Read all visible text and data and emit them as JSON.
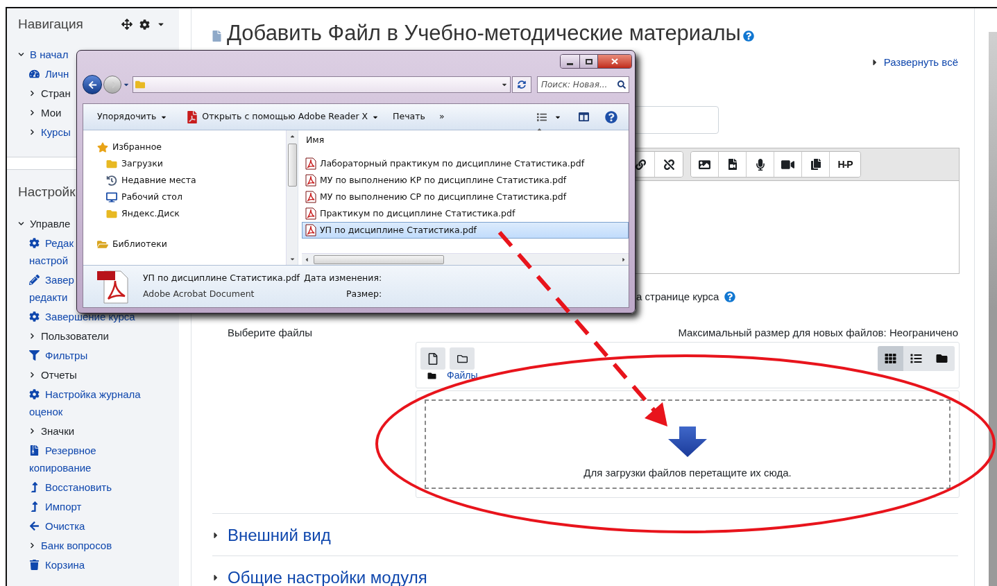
{
  "sidebar": {
    "navigation": {
      "title": "Навигация",
      "items": [
        {
          "label": [
            "В начал"
          ],
          "kind": "branch",
          "expanded": true,
          "link": true,
          "children": [
            {
              "label": [
                "Личн"
              ],
              "kind": "dashboard",
              "link": true
            },
            {
              "label": [
                "Стран"
              ],
              "kind": "branch",
              "expanded": false,
              "link": false
            },
            {
              "label": [
                "Мои"
              ],
              "kind": "branch",
              "expanded": false,
              "link": false
            },
            {
              "label": [
                "Курсы"
              ],
              "kind": "branch",
              "expanded": false,
              "link": true
            }
          ]
        }
      ]
    },
    "settings": {
      "title": "Настройк",
      "items": [
        {
          "label": [
            "Управле"
          ],
          "kind": "branch",
          "expanded": true,
          "link": false,
          "children": [
            {
              "label": [
                "Редак",
                "настрой"
              ],
              "kind": "gear",
              "link": true
            },
            {
              "label": [
                "Завер",
                "редакти"
              ],
              "kind": "pencil",
              "link": true
            },
            {
              "label": [
                "Завершение курса"
              ],
              "kind": "gear",
              "link": true
            },
            {
              "label": [
                "Пользователи"
              ],
              "kind": "branch",
              "expanded": false,
              "link": false
            },
            {
              "label": [
                "Фильтры"
              ],
              "kind": "filter",
              "link": true
            },
            {
              "label": [
                "Отчеты"
              ],
              "kind": "branch",
              "expanded": false,
              "link": false
            },
            {
              "label": [
                "Настройка журнала",
                "оценок"
              ],
              "kind": "gear",
              "link": true
            },
            {
              "label": [
                "Значки"
              ],
              "kind": "branch",
              "expanded": false,
              "link": false
            },
            {
              "label": [
                "Резервное",
                "копирование"
              ],
              "kind": "backup",
              "link": true
            },
            {
              "label": [
                "Восстановить"
              ],
              "kind": "upload",
              "link": true
            },
            {
              "label": [
                "Импорт"
              ],
              "kind": "upload",
              "link": true
            },
            {
              "label": [
                "Очистка"
              ],
              "kind": "back",
              "link": true
            },
            {
              "label": [
                "Банк вопросов"
              ],
              "kind": "branch",
              "expanded": false,
              "link": true
            },
            {
              "label": [
                "Корзина"
              ],
              "kind": "trash",
              "link": true
            }
          ]
        }
      ]
    }
  },
  "page": {
    "title": "Добавить Файл в Учебно-методические материалы",
    "expand_all": "Развернуть всё",
    "editor_h5p": "H-P",
    "option_fragment": "а странице курса",
    "file_picker": {
      "label": "Выберите файлы",
      "max_size": "Максимальный размер для новых файлов: Неограничено",
      "path": "Файлы",
      "views": [
        {
          "kind": "icons",
          "selected": true
        },
        {
          "kind": "list",
          "selected": false
        },
        {
          "kind": "tree",
          "selected": false
        }
      ],
      "drop_hint": "Для загрузки файлов перетащите их сюда."
    },
    "sections": [
      {
        "title": "Внешний вид",
        "expanded": false
      },
      {
        "title": "Общие настройки модуля",
        "expanded": false
      }
    ]
  },
  "explorer_window": {
    "search": {
      "placeholder": "Поиск: Новая..."
    },
    "toolbar": [
      {
        "label": "Упорядочить",
        "kind": "menu"
      },
      {
        "label": "Открыть с помощью Adobe Reader X",
        "kind": "app"
      },
      {
        "label": "Печать",
        "kind": "plain"
      },
      {
        "label": "»",
        "kind": "plain"
      }
    ],
    "nav_pane": [
      {
        "label": "Избранное",
        "kind": "star",
        "children": [
          {
            "label": "Загрузки",
            "kind": "downloads"
          },
          {
            "label": "Недавние места",
            "kind": "recent"
          },
          {
            "label": "Рабочий стол",
            "kind": "desktop"
          },
          {
            "label": "Яндекс.Диск",
            "kind": "folder"
          }
        ]
      },
      {
        "label": "Библиотеки",
        "kind": "library"
      }
    ],
    "file_list": {
      "column": "Имя",
      "files": [
        {
          "name": "Лабораторный практикум по дисциплине Статистика.pdf",
          "selected": false
        },
        {
          "name": "МУ по выполнению КР по дисциплине Статистика.pdf",
          "selected": false
        },
        {
          "name": "МУ по выполнению СР по дисциплине Статистика.pdf",
          "selected": false
        },
        {
          "name": "Практикум по дисциплине Статистика.pdf",
          "selected": false
        },
        {
          "name": "УП по дисциплине Статистика.pdf",
          "selected": true
        }
      ]
    },
    "details": {
      "name": "УП по дисциплине Статистика.pdf",
      "type": "Adobe Acrobat Document",
      "fields": [
        "Дата изменения:",
        "Размер:"
      ]
    }
  }
}
